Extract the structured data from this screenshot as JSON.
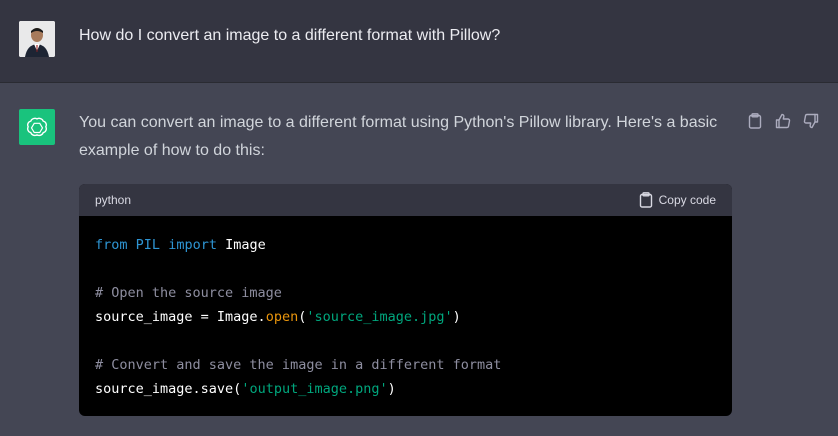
{
  "user_message": {
    "avatar": "user-avatar-photo",
    "text": "How do I convert an image to a different format with Pillow?"
  },
  "assistant_message": {
    "logo": "openai-logo-icon",
    "intro": "You can convert an image to a different format using Python's Pillow library. Here's a basic example of how to do this:",
    "actions": [
      "clipboard-icon",
      "thumbs-up-icon",
      "thumbs-down-icon"
    ],
    "code_block": {
      "language": "python",
      "copy_label": "Copy code",
      "lines": {
        "l1_from": "from",
        "l1_mod": "PIL",
        "l1_import": "import",
        "l1_name": "Image",
        "l3_comment": "# Open the source image",
        "l4_var": "source_image = Image.",
        "l4_method": "open",
        "l4_open": "(",
        "l4_str": "'source_image.jpg'",
        "l4_close": ")",
        "l6_comment": "# Convert and save the image in a different format",
        "l7_call": "source_image.save(",
        "l7_str": "'output_image.png'",
        "l7_close": ")"
      }
    }
  },
  "colors": {
    "user_bg": "#343541",
    "assistant_bg": "#444654",
    "logo_green": "#19c37d",
    "code_bg": "#000000",
    "keyword": "#2e95d3",
    "string": "#00a67d",
    "comment": "#8e8ea0",
    "method": "#e9950c"
  }
}
